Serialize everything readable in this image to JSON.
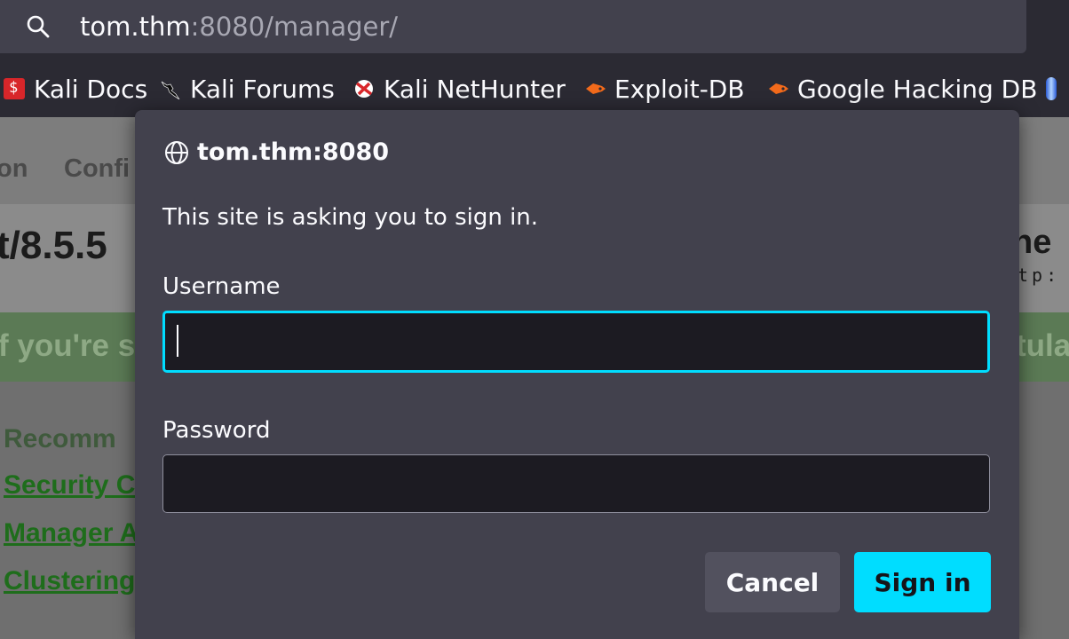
{
  "browser": {
    "url": {
      "host": "tom.thm",
      "rest": ":8080/manager/"
    },
    "bookmarks": [
      {
        "label": "Kali Docs",
        "icon": "kali-docs-icon"
      },
      {
        "label": "Kali Forums",
        "icon": "kali-dragon-icon"
      },
      {
        "label": "Kali NetHunter",
        "icon": "nethunter-icon"
      },
      {
        "label": "Exploit-DB",
        "icon": "exploit-db-icon"
      },
      {
        "label": "Google Hacking DB",
        "icon": "exploit-db-icon"
      }
    ]
  },
  "background_page": {
    "nav": [
      "on",
      "Confi"
    ],
    "version": "t/8.5.5",
    "right_fragment_1": "he",
    "right_fragment_2": "tp:",
    "banner_left": "f you're s",
    "banner_right": "tula",
    "recommended": "Recomm",
    "links": [
      "Security C",
      "Manager A",
      "Clustering"
    ]
  },
  "dialog": {
    "host": "tom.thm:8080",
    "message": "This site is asking you to sign in.",
    "username_label": "Username",
    "username_value": "",
    "password_label": "Password",
    "password_value": "",
    "cancel_label": "Cancel",
    "signin_label": "Sign in"
  },
  "colors": {
    "accent": "#00ddff",
    "dialog_bg": "#42414d",
    "field_bg": "#1c1b22"
  }
}
